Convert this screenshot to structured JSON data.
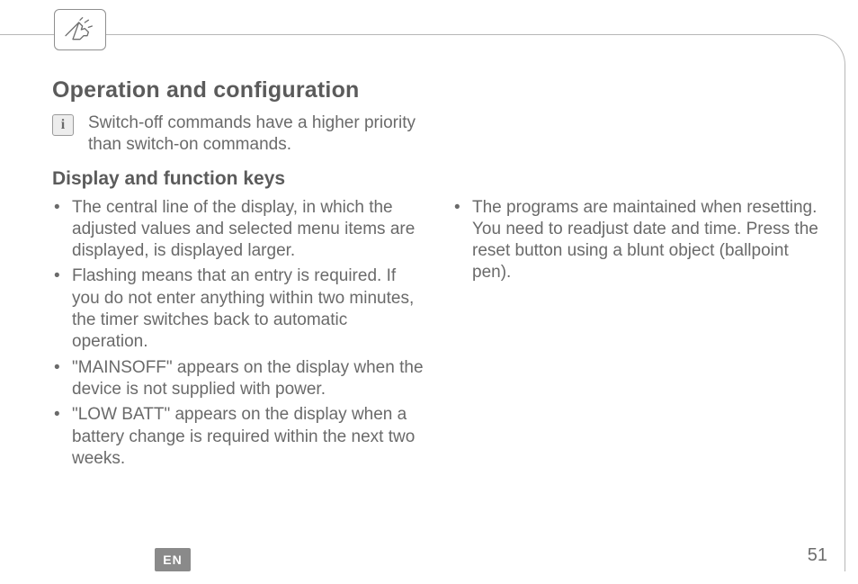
{
  "title": "Operation and configuration",
  "info_note": "Switch-off commands have a higher priority than switch-on commands.",
  "subhead": "Display and function keys",
  "left_bullets": [
    "The central line of the display, in which the adjusted values and selected menu items are displayed, is displayed larger.",
    "Flashing means that an entry is required. If you do not enter anything within two minutes, the timer switches back to automatic operation.",
    "\"MAINSOFF\" appears on the display when the device is not supplied with power.",
    "\"LOW BATT\" appears on the display when a battery change is required within the next two weeks."
  ],
  "right_bullets": [
    "The programs are maintained when resetting. You need to readjust date and time. Press the reset button using a blunt object (ballpoint pen)."
  ],
  "language_tab": "EN",
  "page_number": "51",
  "icons": {
    "corner": "hand-press-icon",
    "info": "info-icon"
  }
}
